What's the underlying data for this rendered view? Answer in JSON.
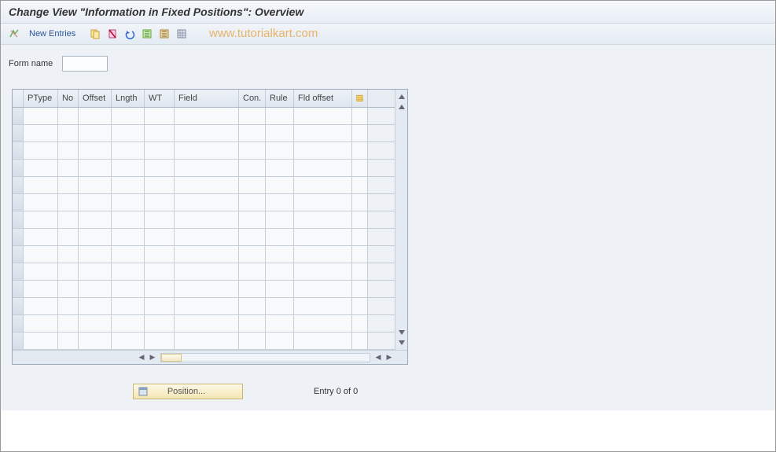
{
  "title": "Change View \"Information in Fixed Positions\": Overview",
  "toolbar": {
    "new_entries_label": "New Entries"
  },
  "watermark": "www.tutorialkart.com",
  "form": {
    "form_name_label": "Form name",
    "form_name_value": ""
  },
  "table": {
    "columns": [
      "PType",
      "No",
      "Offset",
      "Lngth",
      "WT",
      "Field",
      "Con.",
      "Rule",
      "Fld offset"
    ],
    "rows": []
  },
  "footer": {
    "position_label": "Position...",
    "entry_text": "Entry 0 of 0"
  }
}
